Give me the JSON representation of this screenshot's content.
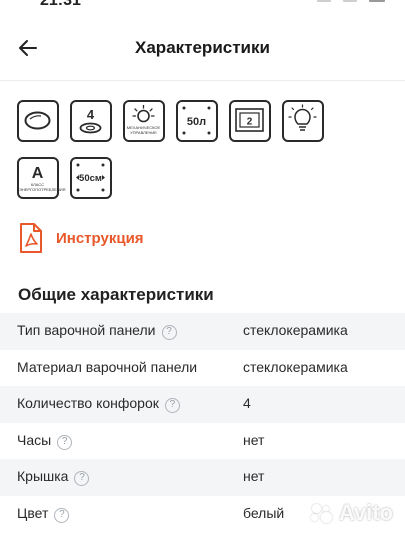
{
  "status": {
    "time": "21:31"
  },
  "header": {
    "title": "Характеристики"
  },
  "feature_icons": [
    {
      "name": "hob-surface-icon"
    },
    {
      "name": "four-burners-icon",
      "text": "4"
    },
    {
      "name": "mechanical-control-icon",
      "caption": "МЕХАНИЧЕСКОЕ УПРАВЛЕНИЕ"
    },
    {
      "name": "oven-volume-icon",
      "text": "50л"
    },
    {
      "name": "two-glass-door-icon",
      "text": "2"
    },
    {
      "name": "lamp-icon"
    },
    {
      "name": "energy-class-icon",
      "text": "A",
      "caption": "КЛАСС ЭНЕРГОПОТРЕБЛЕНИЯ"
    },
    {
      "name": "width-icon",
      "text": "50см"
    }
  ],
  "instruction": {
    "label": "Инструкция"
  },
  "section": {
    "title": "Общие характеристики"
  },
  "specs": [
    {
      "label": "Тип варочной панели",
      "value": "стеклокерамика",
      "help": true
    },
    {
      "label": "Материал варочной панели",
      "value": "стеклокерамика",
      "help": false
    },
    {
      "label": "Количество конфорок",
      "value": "4",
      "help": true
    },
    {
      "label": "Часы",
      "value": "нет",
      "help": true
    },
    {
      "label": "Крышка",
      "value": "нет",
      "help": true
    },
    {
      "label": "Цвет",
      "value": "белый",
      "help": true
    }
  ],
  "help_glyph": "?",
  "watermark": {
    "text": "Avito"
  },
  "colors": {
    "accent": "#e8582a",
    "stripe": "#f4f5f7",
    "text": "#2a2a2a"
  }
}
